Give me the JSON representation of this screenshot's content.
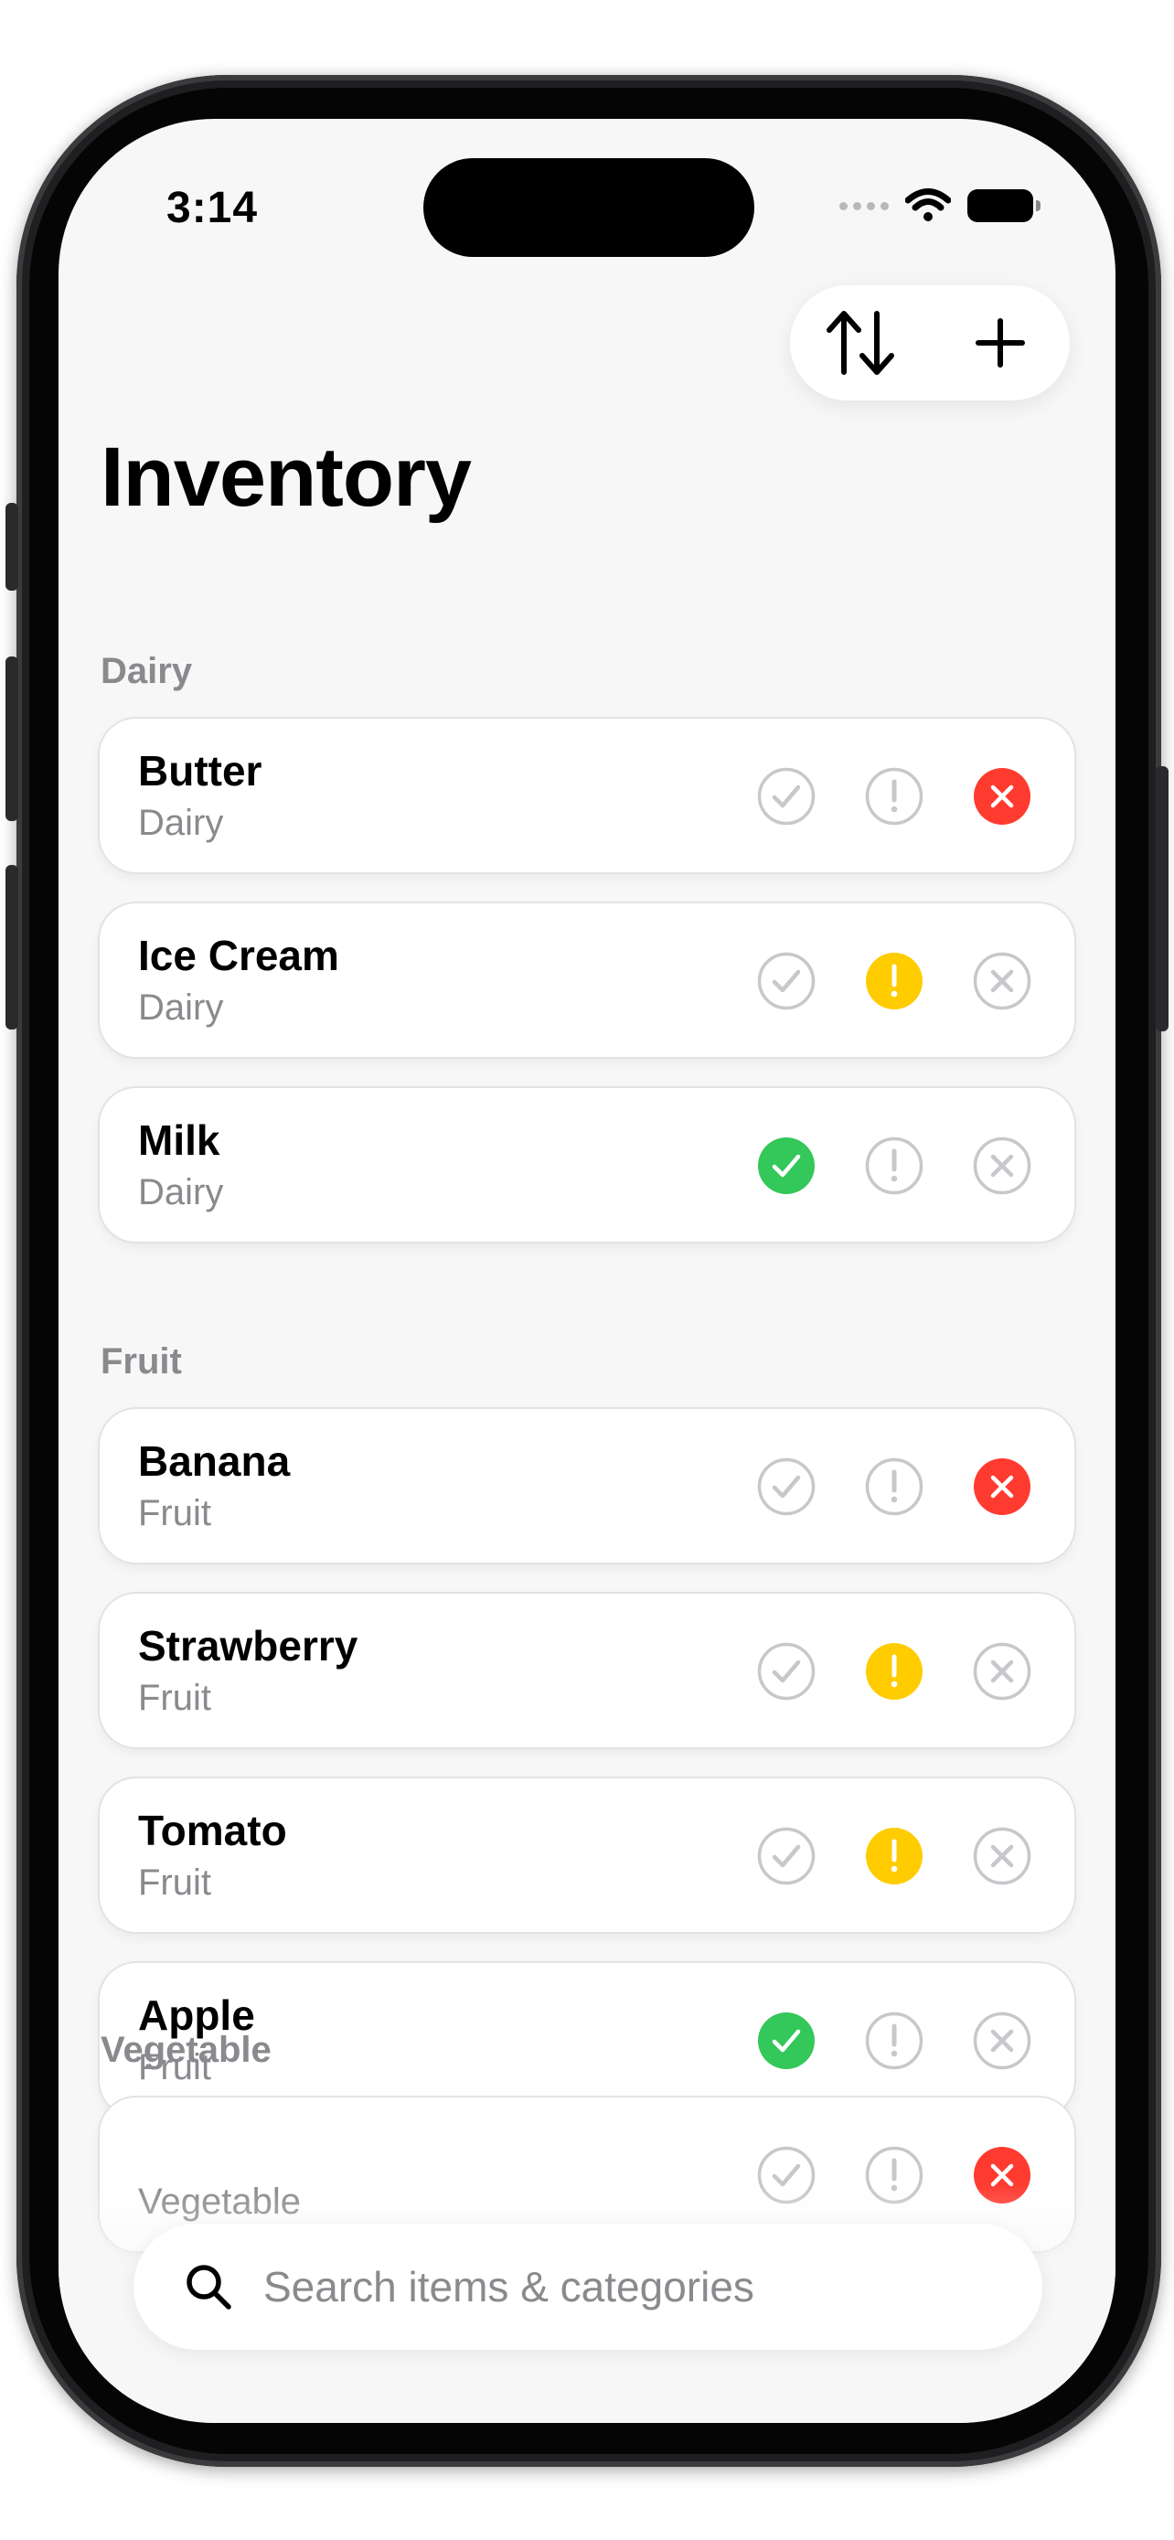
{
  "status_bar": {
    "time": "3:14"
  },
  "toolbar": {
    "sort_icon": "sort-arrows-icon",
    "add_icon": "plus-icon"
  },
  "page": {
    "title": "Inventory"
  },
  "colors": {
    "ok": "#34c759",
    "low": "#ffcc00",
    "out": "#ff3b30",
    "inactive": "#c7c7cc"
  },
  "sections": [
    {
      "header": "Dairy",
      "items": [
        {
          "name": "Butter",
          "category": "Dairy",
          "status": "out"
        },
        {
          "name": "Ice Cream",
          "category": "Dairy",
          "status": "low"
        },
        {
          "name": "Milk",
          "category": "Dairy",
          "status": "ok"
        }
      ]
    },
    {
      "header": "Fruit",
      "items": [
        {
          "name": "Banana",
          "category": "Fruit",
          "status": "out"
        },
        {
          "name": "Strawberry",
          "category": "Fruit",
          "status": "low"
        },
        {
          "name": "Tomato",
          "category": "Fruit",
          "status": "low"
        },
        {
          "name": "Apple",
          "category": "Fruit",
          "status": "ok"
        }
      ]
    },
    {
      "header": "Vegetable",
      "items": [
        {
          "name": "",
          "category": "Vegetable",
          "status": "out"
        }
      ]
    }
  ],
  "search": {
    "placeholder": "Search items & categories",
    "value": ""
  }
}
